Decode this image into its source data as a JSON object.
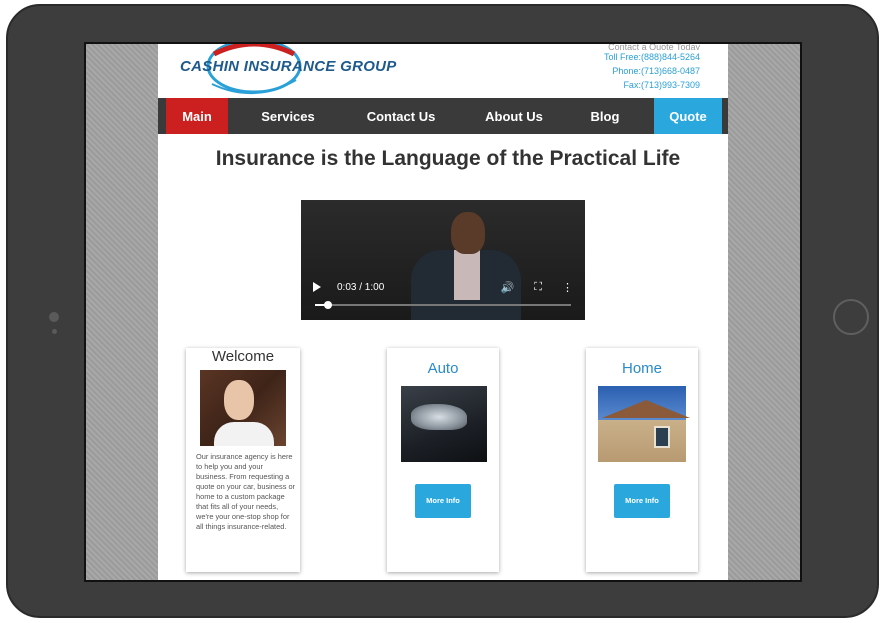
{
  "header": {
    "logo_text": "CASHIN INSURANCE GROUP",
    "contact_top": "Contact a Quote Today",
    "toll_free": "Toll Free:(888)844-5264",
    "phone": "Phone:(713)668-0487",
    "fax": "Fax:(713)993-7309"
  },
  "nav": {
    "items": [
      {
        "label": "Main"
      },
      {
        "label": "Services"
      },
      {
        "label": "Contact Us"
      },
      {
        "label": "About Us"
      },
      {
        "label": "Blog"
      },
      {
        "label": "Quote"
      }
    ],
    "active_color": "#cc1f1f",
    "quote_color": "#2aa8de"
  },
  "main": {
    "headline": "Insurance is the Language of the Practical Life",
    "video": {
      "time": "0:03 / 1:00",
      "progress": 0.05
    }
  },
  "cards": {
    "welcome": {
      "title": "Welcome",
      "text": "Our insurance agency is here to help you and your business. From requesting a quote on your car, business or home to a custom package that fits all of your needs, we're your one-stop shop for all things insurance-related."
    },
    "auto": {
      "title": "Auto",
      "button": "More Info"
    },
    "home": {
      "title": "Home",
      "button": "More Info"
    }
  }
}
